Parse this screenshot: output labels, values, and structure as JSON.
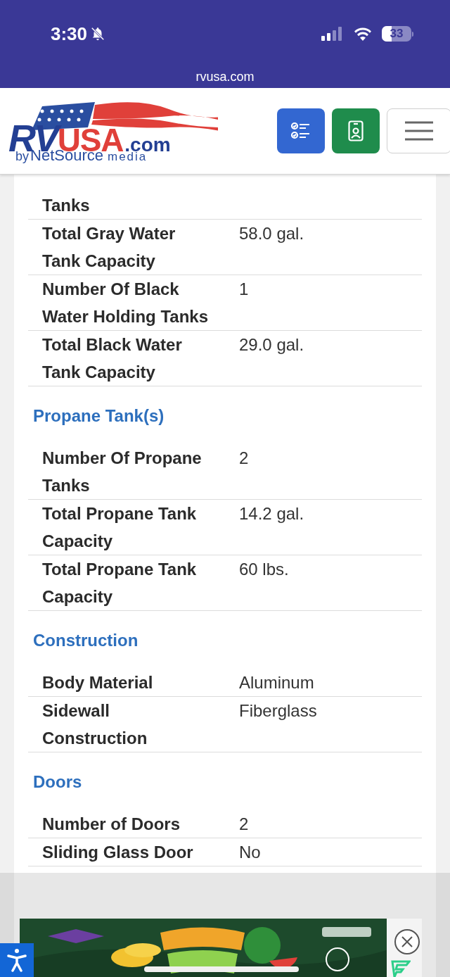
{
  "status_bar": {
    "time": "3:30",
    "battery": "33"
  },
  "browser": {
    "url": "rvusa.com"
  },
  "logo": {
    "rv": "RV",
    "usa": "USA",
    "com": ".com",
    "by": "by",
    "netsource": "NetSource",
    "media": "media"
  },
  "sections": [
    {
      "rows": [
        {
          "label": "Tanks",
          "value": ""
        },
        {
          "label": "Total Gray Water Tank Capacity",
          "value": "58.0 gal."
        },
        {
          "label": "Number Of Black Water Holding Tanks",
          "value": "1"
        },
        {
          "label": "Total Black Water Tank Capacity",
          "value": "29.0 gal."
        }
      ]
    },
    {
      "heading": "Propane Tank(s)",
      "rows": [
        {
          "label": "Number Of Propane Tanks",
          "value": "2"
        },
        {
          "label": "Total Propane Tank Capacity",
          "value": "14.2 gal."
        },
        {
          "label": "Total Propane Tank Capacity",
          "value": "60 lbs."
        }
      ]
    },
    {
      "heading": "Construction",
      "rows": [
        {
          "label": "Body Material",
          "value": "Aluminum"
        },
        {
          "label": "Sidewall Construction",
          "value": "Fiberglass"
        }
      ]
    },
    {
      "heading": "Doors",
      "rows": [
        {
          "label": "Number of Doors",
          "value": "2"
        },
        {
          "label": "Sliding Glass Door",
          "value": "No"
        }
      ]
    }
  ]
}
